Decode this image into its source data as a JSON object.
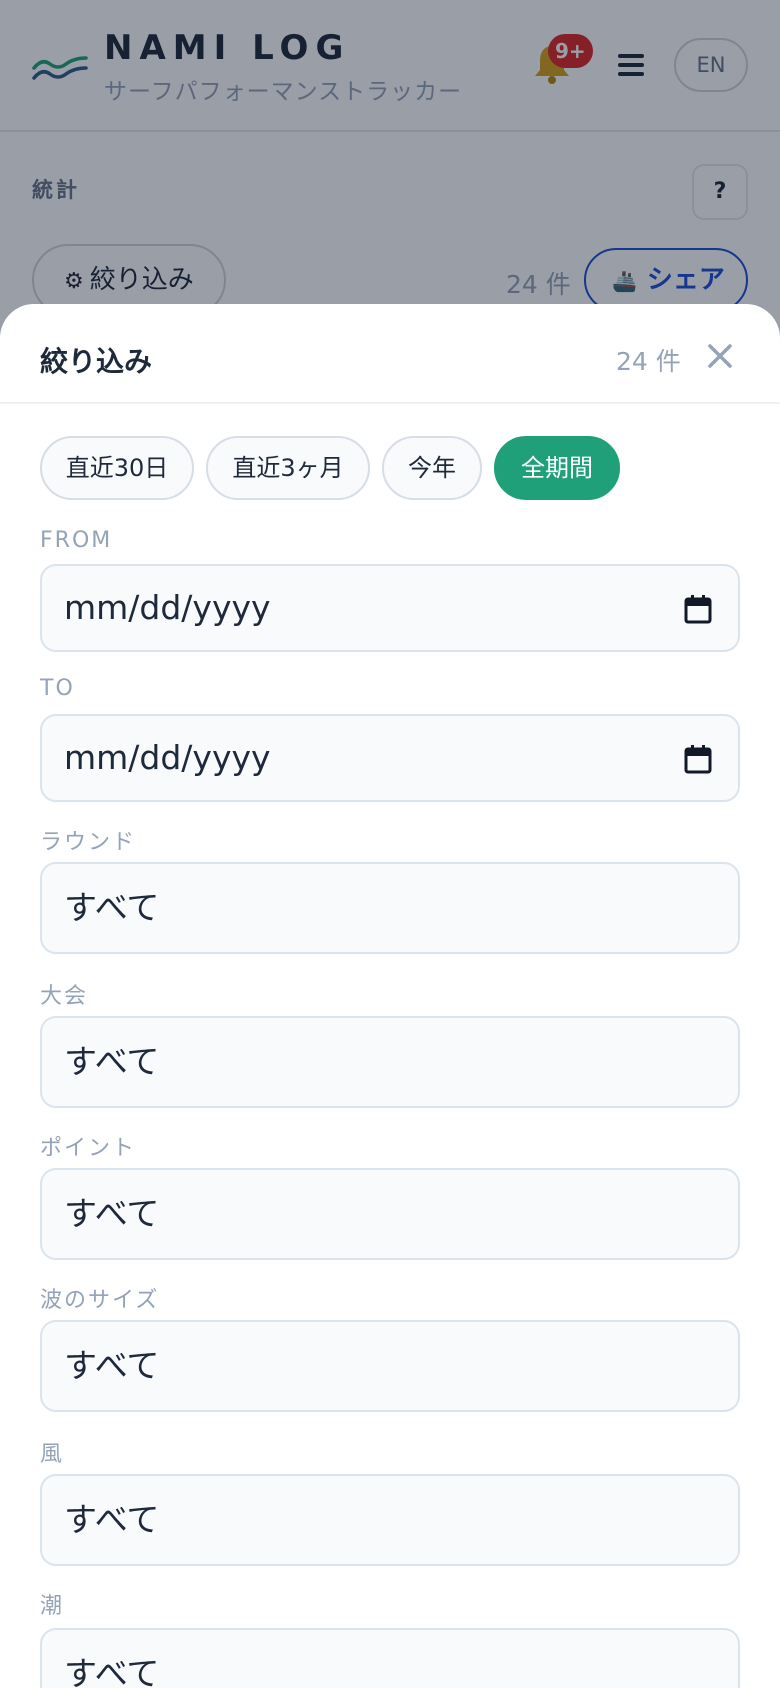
{
  "app": {
    "brand_title": "NAMI LOG",
    "brand_subtitle": "サーフパフォーマンストラッカー",
    "notification_badge": "9+",
    "lang_button": "EN",
    "section_label": "統計",
    "help_button": "?",
    "filter_button": "絞り込み",
    "count": "24 件",
    "share_button": "シェア"
  },
  "sheet": {
    "title": "絞り込み",
    "count": "24 件",
    "chips": [
      {
        "label": "直近30日",
        "active": false
      },
      {
        "label": "直近3ヶ月",
        "active": false
      },
      {
        "label": "今年",
        "active": false
      },
      {
        "label": "全期間",
        "active": true
      }
    ],
    "fields": [
      {
        "label": "FROM",
        "value": "mm/dd/yyyy",
        "type": "date"
      },
      {
        "label": "TO",
        "value": "mm/dd/yyyy",
        "type": "date"
      },
      {
        "label": "ラウンド",
        "value": "すべて",
        "type": "select"
      },
      {
        "label": "大会",
        "value": "すべて",
        "type": "select"
      },
      {
        "label": "ポイント",
        "value": "すべて",
        "type": "select"
      },
      {
        "label": "波のサイズ",
        "value": "すべて",
        "type": "select"
      },
      {
        "label": "風",
        "value": "すべて",
        "type": "select"
      },
      {
        "label": "潮",
        "value": "すべて",
        "type": "select"
      }
    ]
  },
  "colors": {
    "accent": "#1fa078",
    "share": "#1d4ed8",
    "badge": "#dc2626",
    "wave_primary": "#1fa078",
    "wave_secondary": "#2f5c8a"
  }
}
